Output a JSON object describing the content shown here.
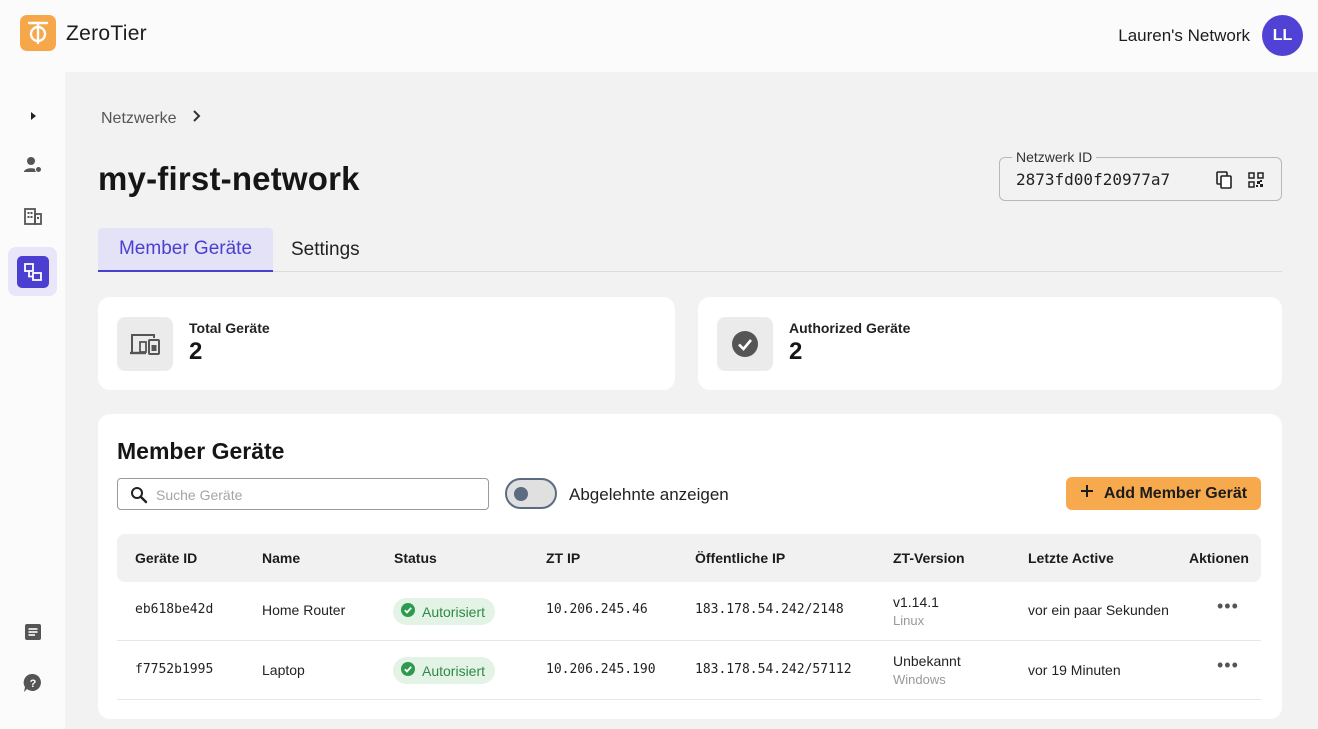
{
  "app": {
    "title": "ZeroTier",
    "network_name": "Lauren's Network",
    "avatar_initials": "LL"
  },
  "sidebar": {
    "items": [
      {
        "icon": "chevron-right-icon"
      },
      {
        "icon": "user-settings-icon"
      },
      {
        "icon": "building-icon"
      },
      {
        "icon": "network-icon",
        "active": true
      },
      {
        "icon": "document-icon"
      },
      {
        "icon": "help-icon"
      }
    ]
  },
  "breadcrumb": {
    "item": "Netzwerke"
  },
  "page": {
    "title": "my-first-network"
  },
  "network_id": {
    "label": "Netzwerk ID",
    "value": "2873fd00f20977a7"
  },
  "tabs": [
    {
      "label": "Member Geräte",
      "active": true
    },
    {
      "label": "Settings",
      "active": false
    }
  ],
  "stats": [
    {
      "label": "Total Geräte",
      "value": "2"
    },
    {
      "label": "Authorized Geräte",
      "value": "2"
    }
  ],
  "members": {
    "title": "Member Geräte",
    "search_placeholder": "Suche Geräte",
    "toggle_label": "Abgelehnte anzeigen",
    "toggle_on": false,
    "add_button": "Add Member Gerät",
    "columns": [
      "Geräte ID",
      "Name",
      "Status",
      "ZT IP",
      "Öffentliche IP",
      "ZT-Version",
      "Letzte Active",
      "Aktionen"
    ],
    "rows": [
      {
        "id": "eb618be42d",
        "name": "Home Router",
        "status": "Autorisiert",
        "zt_ip": "10.206.245.46",
        "public_ip": "183.178.54.242/2148",
        "version": "v1.14.1",
        "os": "Linux",
        "last_active": "vor ein paar Sekunden"
      },
      {
        "id": "f7752b1995",
        "name": "Laptop",
        "status": "Autorisiert",
        "zt_ip": "10.206.245.190",
        "public_ip": "183.178.54.242/57112",
        "version": "Unbekannt",
        "os": "Windows",
        "last_active": "vor 19 Minuten"
      }
    ]
  },
  "colors": {
    "accent": "#4b3fd1",
    "brand": "#f5a74a",
    "success": "#2e8a46"
  }
}
